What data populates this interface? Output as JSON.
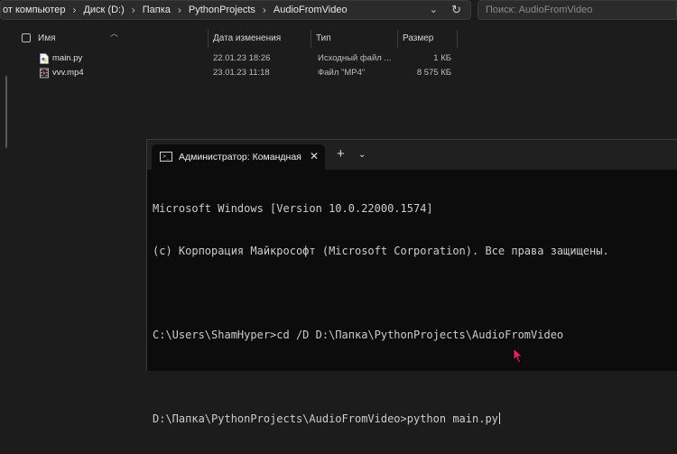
{
  "explorer": {
    "breadcrumbs": [
      "от компьютер",
      "Диск (D:)",
      "Папка",
      "PythonProjects",
      "AudioFromVideo"
    ],
    "search_placeholder": "Поиск: AudioFromVideo",
    "columns": {
      "name": "Имя",
      "date": "Дата изменения",
      "type": "Тип",
      "size": "Размер"
    },
    "files": [
      {
        "name": "main.py",
        "date": "22.01.23 18:26",
        "type": "Исходный файл ...",
        "size": "1 КБ",
        "icon": "python-file-icon"
      },
      {
        "name": "vvv.mp4",
        "date": "23.01.23 11:18",
        "type": "Файл \"MP4\"",
        "size": "8 575 КБ",
        "icon": "video-file-icon"
      }
    ]
  },
  "terminal": {
    "tab_title": "Администратор: Командная",
    "lines": [
      "Microsoft Windows [Version 10.0.22000.1574]",
      "(c) Корпорация Майкрософт (Microsoft Corporation). Все права защищены.",
      "",
      "C:\\Users\\ShamHyper>cd /D D:\\Папка\\PythonProjects\\AudioFromVideo",
      "",
      "D:\\Папка\\PythonProjects\\AudioFromVideo>python main.py"
    ],
    "icons": {
      "tab": "cmd-icon",
      "close": "close-icon",
      "new_tab": "plus-icon",
      "dropdown": "chevron-down-icon"
    }
  },
  "colors": {
    "explorer_bg": "#1c1c1c",
    "terminal_bg": "#0c0c0c",
    "tabbar_bg": "#202020"
  }
}
